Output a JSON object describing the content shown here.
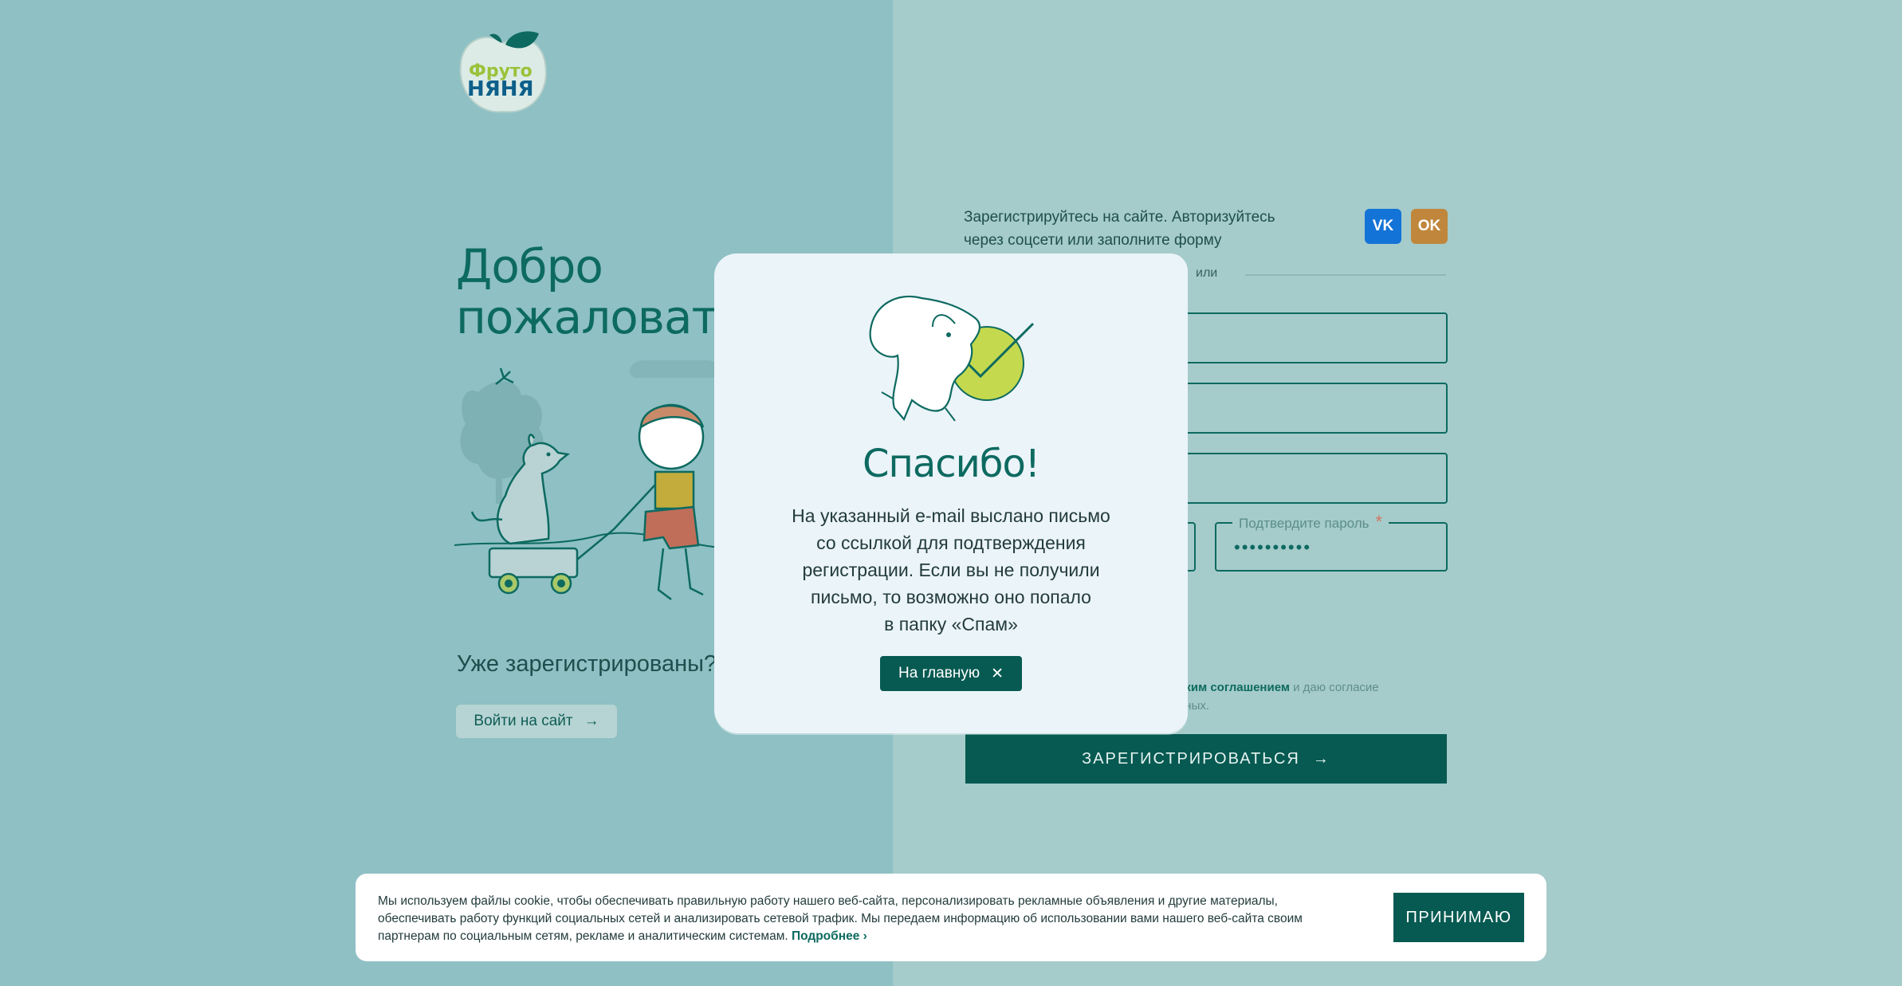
{
  "brand": {
    "logo_line1": "Фрутo",
    "logo_line2": "НЯНЯ"
  },
  "welcome": {
    "title_line1": "Добро",
    "title_line2": "пожаловать!",
    "already_registered": "Уже зарегистрированы?",
    "login_button": "Войти на сайт"
  },
  "register": {
    "hint_line1": "Зарегистрируйтесь на сайте. Авторизуйтесь",
    "hint_line2": "через соцсети или заполните форму вручную",
    "vk_label": "VK",
    "ok_label": "OK",
    "or_text": "или",
    "confirm_password_label": "Подтвердите пароль",
    "required_mark": "*",
    "confirm_password_value": "••••••••••",
    "agree_line1_link": "ским соглашением",
    "agree_line1_rest": " и даю согласие",
    "agree_line2": "нных.",
    "submit_button": "ЗАРЕГИСТРИРОВАТЬСЯ"
  },
  "modal": {
    "title": "Спасибо!",
    "text_line1": "На указанный e-mail выслано письмо",
    "text_line2": "со ссылкой для подтверждения",
    "text_line3": "регистрации. Если вы не получили",
    "text_line4": "письмо, то возможно оно попало",
    "text_line5": "в папку «Спам»",
    "button": "На главную"
  },
  "cookie": {
    "text": "Мы используем файлы cookie, чтобы обеспечивать правильную работу нашего веб-сайта, персонализировать рекламные объявления и другие материалы, обеспечивать работу функций социальных сетей и анализировать сетевой трафик. Мы передаем информацию об использовании вами нашего веб-сайта своим партнерам по социальным сетям, рекламе и аналитическим системам.",
    "more_link": "Подробнее",
    "accept_button": "ПРИНИМАЮ"
  },
  "colors": {
    "page_left": "#8ec0c4",
    "page_right": "#a5cbcb",
    "accent": "#075a52",
    "vk": "#1473d6",
    "ok": "#c0873c"
  }
}
